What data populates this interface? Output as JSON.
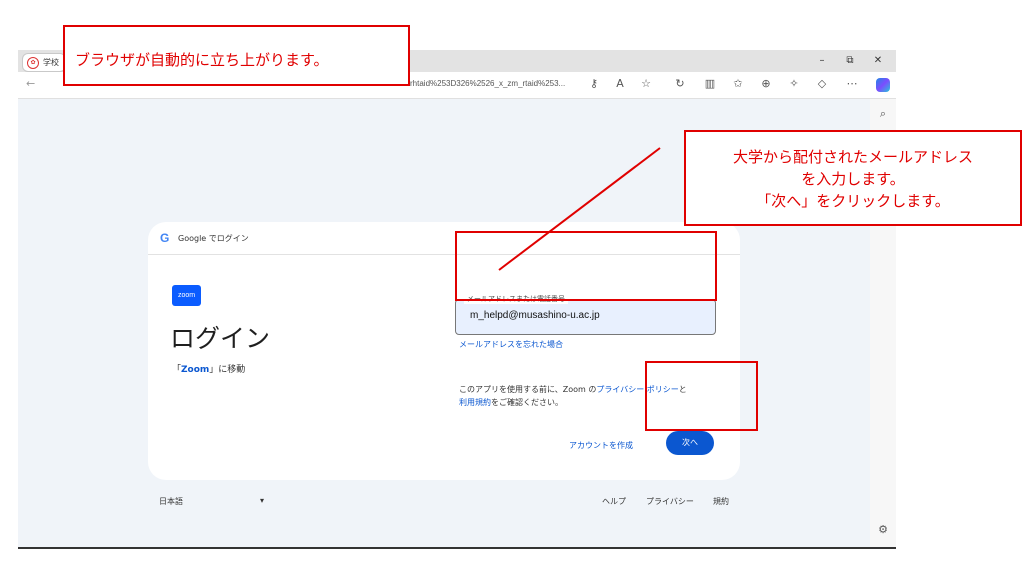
{
  "browser": {
    "tab_label": "学校",
    "url": "rhtaid%253D326%2526_x_zm_rtaid%253...",
    "window_controls": {
      "minimize": "–",
      "restore": "⧉",
      "close": "✕"
    }
  },
  "page": {
    "header_text": "Google でログイン",
    "google_letter": "G",
    "app_logo_text": "zoom",
    "title": "ログイン",
    "subtitle_prefix": "「",
    "subtitle_app": "Zoom",
    "subtitle_suffix": "」に移動",
    "email_label": "メールアドレスまたは電話番号",
    "email_value": "m_helpd@musashino-u.ac.jp",
    "forgot_email": "メールアドレスを忘れた場合",
    "consent_line1_prefix": "このアプリを使用する前に、Zoom の",
    "consent_privacy_link": "プライバシー ポリシー",
    "consent_line1_suffix": "と",
    "consent_terms_link": "利用規約",
    "consent_line2_suffix": "をご確認ください。",
    "create_account": "アカウントを作成",
    "next_button": "次へ"
  },
  "footer": {
    "language": "日本語",
    "help": "ヘルプ",
    "privacy": "プライバシー",
    "terms": "規約"
  },
  "annotations": {
    "browser_launch": "ブラウザが自動的に立ち上がります。",
    "instructions_line1": "大学から配付されたメールアドレス",
    "instructions_line2": "を入力します。",
    "instructions_line3": "「次へ」をクリックします。"
  },
  "colors": {
    "annotation_red": "#e00000",
    "google_blue": "#0b57d0",
    "zoom_blue": "#0b5cff"
  }
}
